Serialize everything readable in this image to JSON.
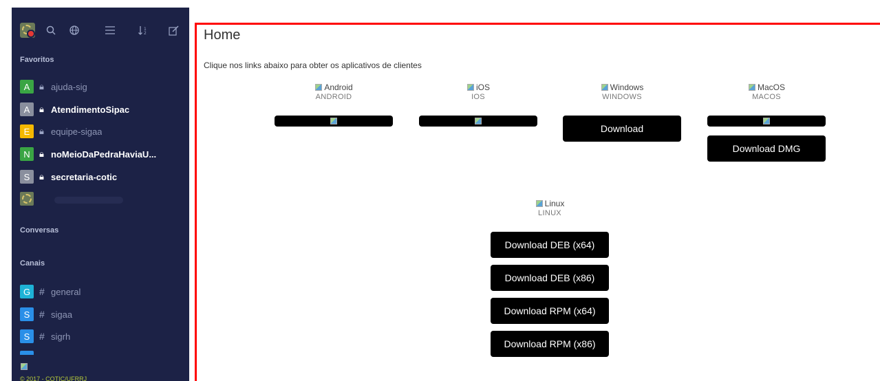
{
  "sidebar": {
    "toolbar_icons": [
      "search-icon",
      "globe-icon",
      "list-icon",
      "sort-icon",
      "edit-icon"
    ],
    "favorites_title": "Favoritos",
    "favorites": [
      {
        "avatar": "A",
        "color": "#3aa544",
        "name": "ajuda-sig",
        "bold": false
      },
      {
        "avatar": "A",
        "color": "#8a8f9e",
        "name": "AtendimentoSipac",
        "bold": true
      },
      {
        "avatar": "E",
        "color": "#f5b800",
        "name": "equipe-sigaa",
        "bold": false
      },
      {
        "avatar": "N",
        "color": "#3aa544",
        "name": "noMeioDaPedraHaviaU...",
        "bold": true
      },
      {
        "avatar": "S",
        "color": "#8a8f9e",
        "name": "secretaria-cotic",
        "bold": true
      }
    ],
    "conversations_title": "Conversas",
    "channels_title": "Canais",
    "channels": [
      {
        "avatar": "G",
        "color": "#1eb2d6",
        "name": "general"
      },
      {
        "avatar": "S",
        "color": "#2a8fe8",
        "name": "sigaa"
      },
      {
        "avatar": "S",
        "color": "#2a8fe8",
        "name": "sigrh"
      }
    ],
    "footer": "© 2017 - COTIC/UFRRJ"
  },
  "main": {
    "title": "Home",
    "intro": "Clique nos links abaixo para obter os aplicativos de clientes",
    "platforms": [
      {
        "alt": "Android",
        "name": "ANDROID"
      },
      {
        "alt": "iOS",
        "name": "IOS"
      },
      {
        "alt": "Windows",
        "name": "WINDOWS",
        "button": "Download"
      },
      {
        "alt": "MacOS",
        "name": "MACOS",
        "button": "Download DMG"
      }
    ],
    "linux": {
      "alt": "Linux",
      "name": "LINUX",
      "buttons": [
        "Download DEB (x64)",
        "Download DEB (x86)",
        "Download RPM (x64)",
        "Download RPM (x86)"
      ]
    }
  },
  "colors": {
    "sidebar_bg": "#1c2246",
    "highlight_border": "#ff0000",
    "button_bg": "#000000"
  }
}
